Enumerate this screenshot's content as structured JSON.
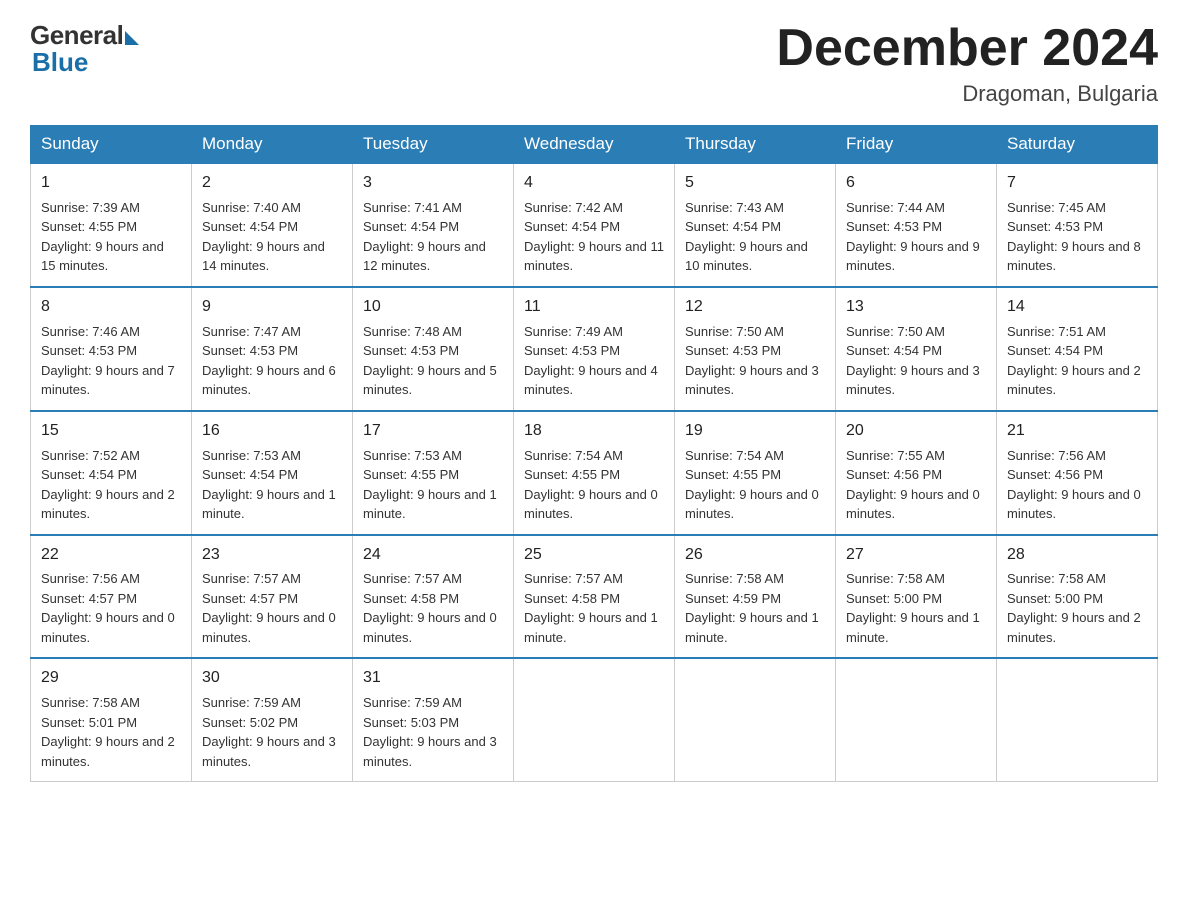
{
  "header": {
    "logo_general": "General",
    "logo_blue": "Blue",
    "month_title": "December 2024",
    "location": "Dragoman, Bulgaria"
  },
  "days_of_week": [
    "Sunday",
    "Monday",
    "Tuesday",
    "Wednesday",
    "Thursday",
    "Friday",
    "Saturday"
  ],
  "weeks": [
    [
      {
        "day": "1",
        "sunrise": "7:39 AM",
        "sunset": "4:55 PM",
        "daylight": "9 hours and 15 minutes."
      },
      {
        "day": "2",
        "sunrise": "7:40 AM",
        "sunset": "4:54 PM",
        "daylight": "9 hours and 14 minutes."
      },
      {
        "day": "3",
        "sunrise": "7:41 AM",
        "sunset": "4:54 PM",
        "daylight": "9 hours and 12 minutes."
      },
      {
        "day": "4",
        "sunrise": "7:42 AM",
        "sunset": "4:54 PM",
        "daylight": "9 hours and 11 minutes."
      },
      {
        "day": "5",
        "sunrise": "7:43 AM",
        "sunset": "4:54 PM",
        "daylight": "9 hours and 10 minutes."
      },
      {
        "day": "6",
        "sunrise": "7:44 AM",
        "sunset": "4:53 PM",
        "daylight": "9 hours and 9 minutes."
      },
      {
        "day": "7",
        "sunrise": "7:45 AM",
        "sunset": "4:53 PM",
        "daylight": "9 hours and 8 minutes."
      }
    ],
    [
      {
        "day": "8",
        "sunrise": "7:46 AM",
        "sunset": "4:53 PM",
        "daylight": "9 hours and 7 minutes."
      },
      {
        "day": "9",
        "sunrise": "7:47 AM",
        "sunset": "4:53 PM",
        "daylight": "9 hours and 6 minutes."
      },
      {
        "day": "10",
        "sunrise": "7:48 AM",
        "sunset": "4:53 PM",
        "daylight": "9 hours and 5 minutes."
      },
      {
        "day": "11",
        "sunrise": "7:49 AM",
        "sunset": "4:53 PM",
        "daylight": "9 hours and 4 minutes."
      },
      {
        "day": "12",
        "sunrise": "7:50 AM",
        "sunset": "4:53 PM",
        "daylight": "9 hours and 3 minutes."
      },
      {
        "day": "13",
        "sunrise": "7:50 AM",
        "sunset": "4:54 PM",
        "daylight": "9 hours and 3 minutes."
      },
      {
        "day": "14",
        "sunrise": "7:51 AM",
        "sunset": "4:54 PM",
        "daylight": "9 hours and 2 minutes."
      }
    ],
    [
      {
        "day": "15",
        "sunrise": "7:52 AM",
        "sunset": "4:54 PM",
        "daylight": "9 hours and 2 minutes."
      },
      {
        "day": "16",
        "sunrise": "7:53 AM",
        "sunset": "4:54 PM",
        "daylight": "9 hours and 1 minute."
      },
      {
        "day": "17",
        "sunrise": "7:53 AM",
        "sunset": "4:55 PM",
        "daylight": "9 hours and 1 minute."
      },
      {
        "day": "18",
        "sunrise": "7:54 AM",
        "sunset": "4:55 PM",
        "daylight": "9 hours and 0 minutes."
      },
      {
        "day": "19",
        "sunrise": "7:54 AM",
        "sunset": "4:55 PM",
        "daylight": "9 hours and 0 minutes."
      },
      {
        "day": "20",
        "sunrise": "7:55 AM",
        "sunset": "4:56 PM",
        "daylight": "9 hours and 0 minutes."
      },
      {
        "day": "21",
        "sunrise": "7:56 AM",
        "sunset": "4:56 PM",
        "daylight": "9 hours and 0 minutes."
      }
    ],
    [
      {
        "day": "22",
        "sunrise": "7:56 AM",
        "sunset": "4:57 PM",
        "daylight": "9 hours and 0 minutes."
      },
      {
        "day": "23",
        "sunrise": "7:57 AM",
        "sunset": "4:57 PM",
        "daylight": "9 hours and 0 minutes."
      },
      {
        "day": "24",
        "sunrise": "7:57 AM",
        "sunset": "4:58 PM",
        "daylight": "9 hours and 0 minutes."
      },
      {
        "day": "25",
        "sunrise": "7:57 AM",
        "sunset": "4:58 PM",
        "daylight": "9 hours and 1 minute."
      },
      {
        "day": "26",
        "sunrise": "7:58 AM",
        "sunset": "4:59 PM",
        "daylight": "9 hours and 1 minute."
      },
      {
        "day": "27",
        "sunrise": "7:58 AM",
        "sunset": "5:00 PM",
        "daylight": "9 hours and 1 minute."
      },
      {
        "day": "28",
        "sunrise": "7:58 AM",
        "sunset": "5:00 PM",
        "daylight": "9 hours and 2 minutes."
      }
    ],
    [
      {
        "day": "29",
        "sunrise": "7:58 AM",
        "sunset": "5:01 PM",
        "daylight": "9 hours and 2 minutes."
      },
      {
        "day": "30",
        "sunrise": "7:59 AM",
        "sunset": "5:02 PM",
        "daylight": "9 hours and 3 minutes."
      },
      {
        "day": "31",
        "sunrise": "7:59 AM",
        "sunset": "5:03 PM",
        "daylight": "9 hours and 3 minutes."
      },
      null,
      null,
      null,
      null
    ]
  ]
}
